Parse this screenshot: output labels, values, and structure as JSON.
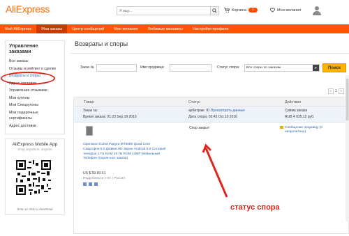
{
  "header": {
    "logo": "AliExpress",
    "search_placeholder": "Я ищу...",
    "cart_label": "Корзина",
    "cart_count": "1",
    "wishlist_label": "Мои желания",
    "icons": [
      "search-icon",
      "cart-icon",
      "heart-icon",
      "user-avatar-icon"
    ]
  },
  "nav": {
    "items": [
      {
        "label": "Мой AliExpress",
        "active": false
      },
      {
        "label": "Мои заказы",
        "active": true
      },
      {
        "label": "Центр сообщений",
        "active": false
      },
      {
        "label": "Мои желания",
        "active": false
      },
      {
        "label": "Любимые магазины",
        "active": false
      },
      {
        "label": "Настройки профиля",
        "active": false
      }
    ]
  },
  "sidebar": {
    "title": "Управление заказами",
    "links": [
      "Все заказы",
      "Отзывы и рейтинг о сделке",
      "Возвраты и споры",
      "Адрес доставки",
      "Управление отзывами",
      "Мои купоны",
      "Мои Спецкупоны",
      "Мои подарочные сертификаты",
      "Адрес доставки"
    ],
    "active_index": 2,
    "app": {
      "title": "AliExpress Mobile App",
      "subtitle": "Shop anywhere, anytime",
      "footer": "Scan or click to download"
    }
  },
  "main": {
    "title": "Возвраты и споры",
    "filters": {
      "order_label": "Заказ №",
      "product_label": "Имя продавца:",
      "status_label": "Статус спора:",
      "status_value": "Все споры по заказам",
      "search_button": "Поиск"
    },
    "pagination": {
      "current": "1"
    },
    "table": {
      "headers": [
        "Товар",
        "Статус",
        "Действие"
      ],
      "order": {
        "order_no": "Заказ №:",
        "order_date": "Время заказа: 01:23 Sep.19 2016",
        "arbitration": "арбитраж: ID",
        "view_data": "Просмотреть данные",
        "dispute_date": "Дата спора: 02:43 Oct.10 2016",
        "sum_label": "Сумма заказа",
        "sum_value": "RUB 4 035.12 руб."
      },
      "item": {
        "title": "Оригинал Cubot Радуга MT6580 Quad Core Смартфон 5.0 Дюйма HD Экран Android 6.0 Сотовый телефон 1 ГБ RAM 16 ГБ ROM 13MP Мобильный Телефон",
        "snapshot": "(Скрин-шот заказа)",
        "price": "US $ 59.99 X1",
        "ship": "Подробности: Нет | Россия",
        "status": "Спор закрыт",
        "message": "Сообщение продавцу (0 непрочитано)"
      }
    }
  },
  "annotation": {
    "text": "статус спора",
    "color": "#e0251b"
  },
  "colors": {
    "brand": "#ff5500",
    "nav_active": "#cc3a00",
    "link": "#2a64b2",
    "button": "#ffb100"
  }
}
